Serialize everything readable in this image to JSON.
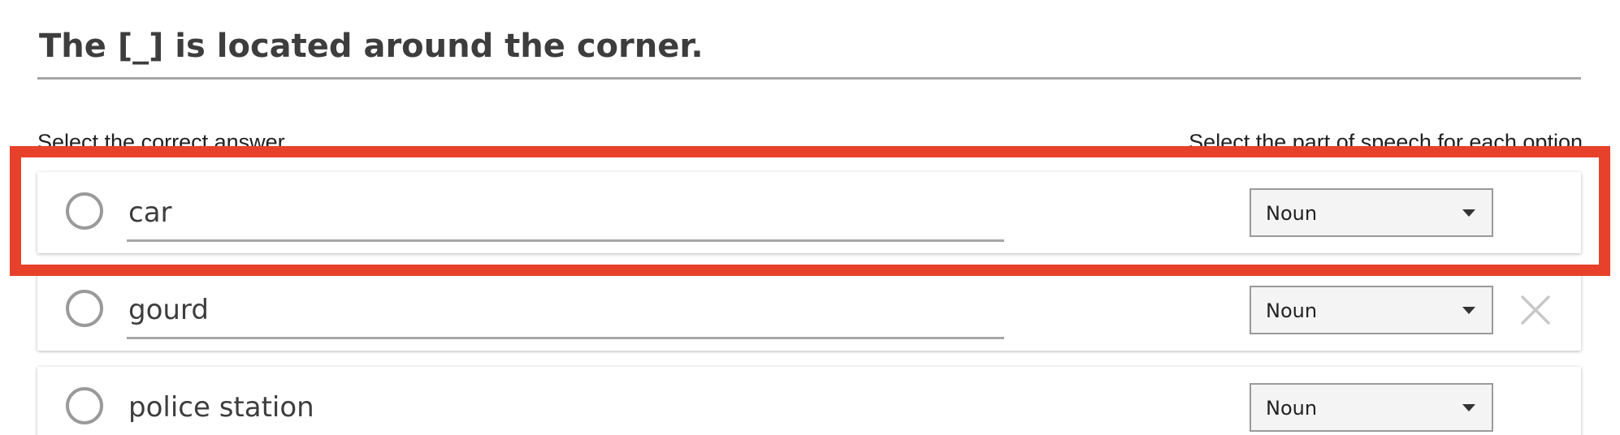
{
  "question": {
    "text": "The [_] is located around the corner."
  },
  "instructions": {
    "left": "Select the correct answer",
    "right": "Select the part of speech for each option"
  },
  "options": [
    {
      "text": "car",
      "part_of_speech": "Noun",
      "selected": false
    },
    {
      "text": "gourd",
      "part_of_speech": "Noun",
      "selected": false
    },
    {
      "text": "police station",
      "part_of_speech": "Noun",
      "selected": false
    }
  ],
  "colors": {
    "highlight": "#e8412b",
    "divider": "#a6a6a6",
    "radio_border": "#9a9a9a",
    "select_bg": "#f4f4f4"
  },
  "icons": {
    "remove": "close-icon",
    "dropdown": "chevron-down-icon"
  }
}
